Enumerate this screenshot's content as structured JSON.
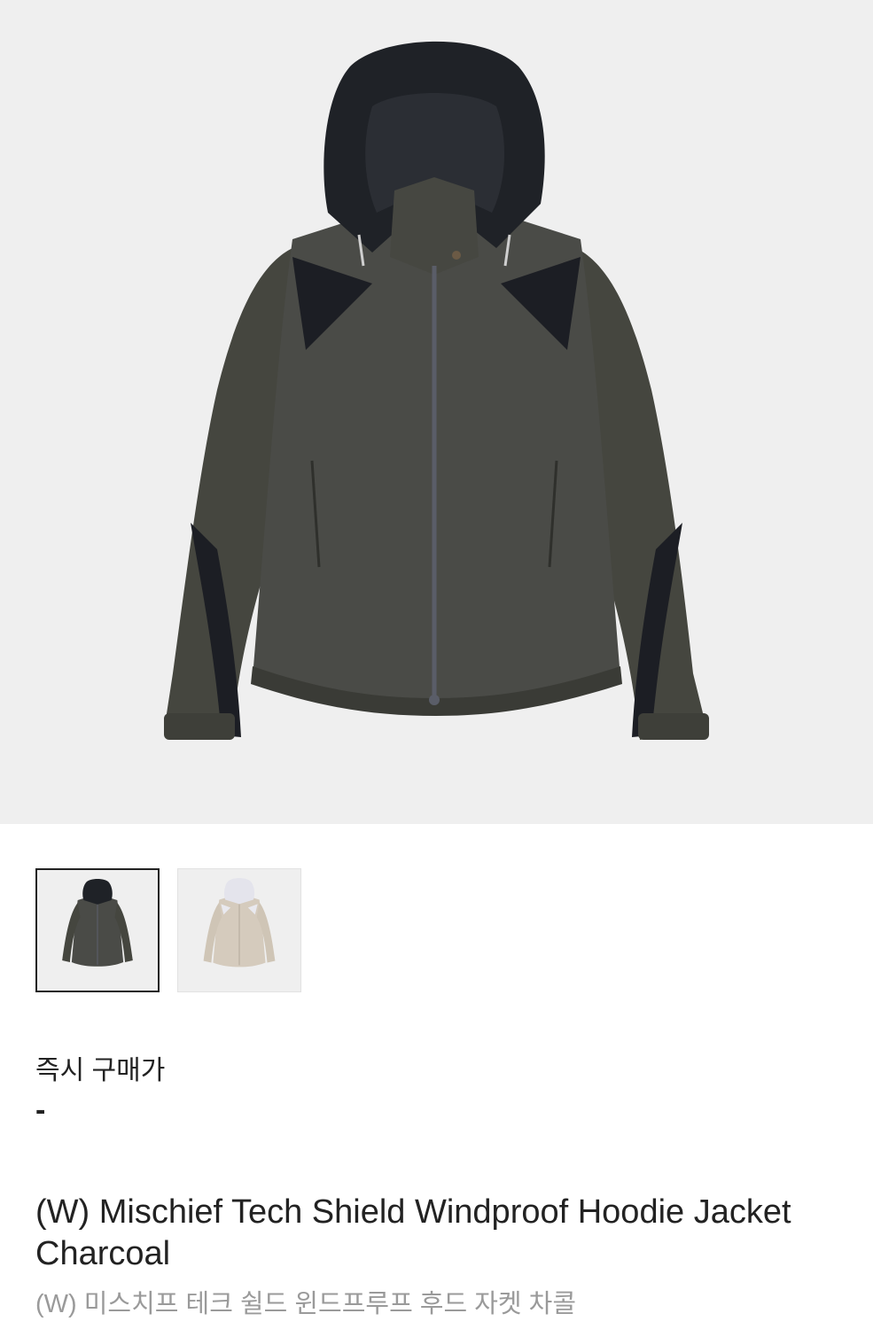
{
  "product": {
    "main_image": {
      "icon": "charcoal-hoodie-jacket-photo",
      "colors": {
        "body": "#4a4b47",
        "hood": "#1f2227",
        "accent": "#1c1e24",
        "background": "#efefef"
      }
    },
    "thumbnails": [
      {
        "icon": "charcoal-jacket-thumbnail",
        "selected": true,
        "color": "#4a4b47"
      },
      {
        "icon": "beige-jacket-thumbnail",
        "selected": false,
        "color": "#d5cbbd"
      }
    ],
    "price_label": "즉시 구매가",
    "price_value": "-",
    "title_en": "(W) Mischief Tech Shield Windproof Hoodie Jacket Charcoal",
    "title_ko": "(W) 미스치프 테크 쉴드 윈드프루프 후드 자켓 차콜"
  }
}
